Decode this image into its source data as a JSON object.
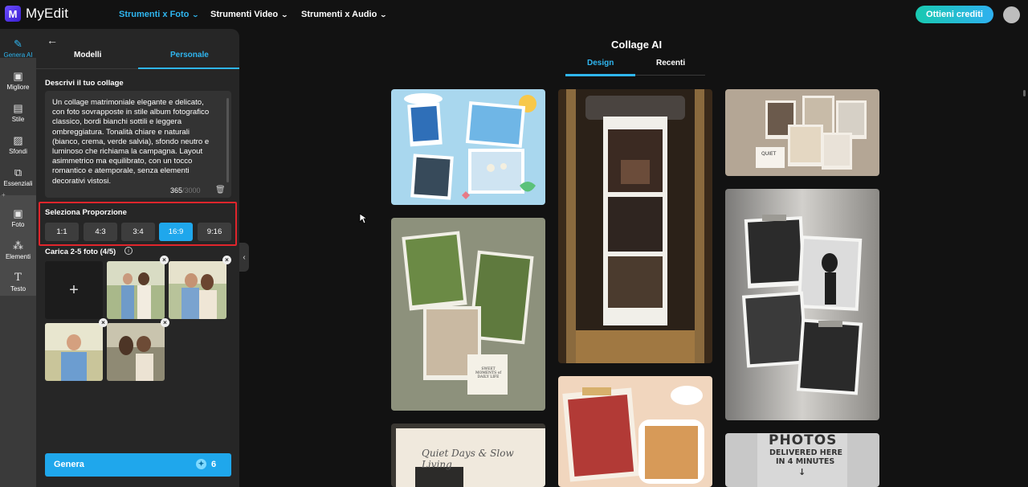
{
  "app": {
    "name": "MyEdit",
    "logo_letter": "M"
  },
  "topnav": {
    "items": [
      {
        "label": "Strumenti x Foto",
        "active": true
      },
      {
        "label": "Strumenti Video",
        "active": false
      },
      {
        "label": "Strumenti x Audio",
        "active": false
      }
    ],
    "credits_button": "Ottieni crediti"
  },
  "rail": {
    "items": [
      {
        "label": "Genera AI",
        "icon": "magic-wand-icon",
        "active": true
      },
      {
        "label": "Migliore",
        "icon": "image-enhance-icon"
      },
      {
        "label": "Stile",
        "icon": "style-icon"
      },
      {
        "label": "Sfondi",
        "icon": "background-icon"
      },
      {
        "label": "Essenziali",
        "icon": "crop-icon"
      },
      {
        "label": "Foto",
        "icon": "photo-icon"
      },
      {
        "label": "Elementi",
        "icon": "elements-icon"
      },
      {
        "label": "Testo",
        "icon": "text-icon"
      }
    ]
  },
  "panel": {
    "tabs": [
      "Modelli",
      "Personale"
    ],
    "selected_tab": "Personale",
    "describe_title": "Descrivi il tuo collage",
    "description": "Un collage matrimoniale elegante e delicato,\ncon foto sovrapposte in stile album fotografico\nclassico, bordi bianchi sottili e leggera\nombreggiatura. Tonalità chiare e naturali\n(bianco, crema, verde salvia), sfondo neutro e\nluminoso che richiama la campagna. Layout\nasimmetrico ma equilibrato, con un tocco\nromantico e atemporale, senza elementi\ndecorativi vistosi.",
    "char_count": "365",
    "char_max": "/3000",
    "ratio_title": "Seleziona Proporzione",
    "ratios": [
      "1:1",
      "4:3",
      "3:4",
      "16:9",
      "9:16"
    ],
    "selected_ratio": "16:9",
    "upload_title": "Carica 2-5 foto (4/5)",
    "upload_add": "+",
    "generate_label": "Genera",
    "generate_cost": "6"
  },
  "main": {
    "title": "Collage AI",
    "tabs": [
      "Design",
      "Recenti"
    ],
    "selected_tab": "Design",
    "card_texts": {
      "quiet_days": "Quiet Days & Slow Living",
      "photos_line1": "PHOTOS",
      "photos_line2": "DELIVERED HERE",
      "photos_line3": "IN 4 MINUTES",
      "quiet_small": "QUIET",
      "sweet_moments": "SWEET MOMENTS of DAILY LIFE"
    }
  },
  "colors": {
    "accent": "#1fa7ec",
    "highlight_border": "#e0252c",
    "credits_gradient": "#19c9b0"
  }
}
